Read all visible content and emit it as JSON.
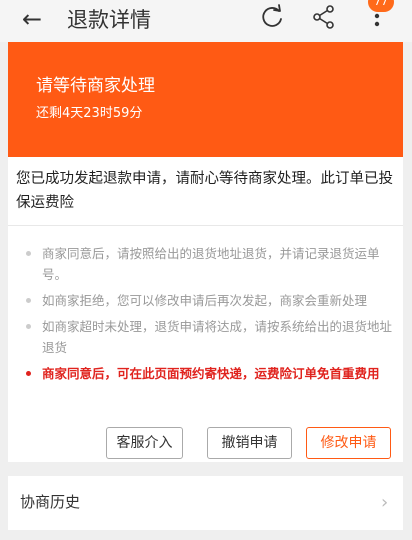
{
  "header": {
    "back_icon": "←",
    "title": "退款详情",
    "refresh_icon": "refresh-icon",
    "share_icon": "share-icon",
    "more_icon": "more-icon",
    "badge": "77"
  },
  "banner": {
    "title": "请等待商家处理",
    "countdown": "还剩4天23时59分",
    "color": "#ff5a14"
  },
  "message": "您已成功发起退款申请，请耐心等待商家处理。此订单已投保运费险",
  "notes": [
    "商家同意后，请按照给出的退货地址退货，并请记录退货运单号。",
    "如商家拒绝，您可以修改申请后再次发起，商家会重新处理",
    "如商家超时未处理，退货申请将达成，请按系统给出的退货地址退货",
    "商家同意后，可在此页面预约寄快递，运费险订单免首重费用"
  ],
  "buttons": {
    "service": "客服介入",
    "cancel": "撤销申请",
    "modify": "修改申请"
  },
  "history": {
    "label": "协商历史",
    "chevron": "›"
  }
}
